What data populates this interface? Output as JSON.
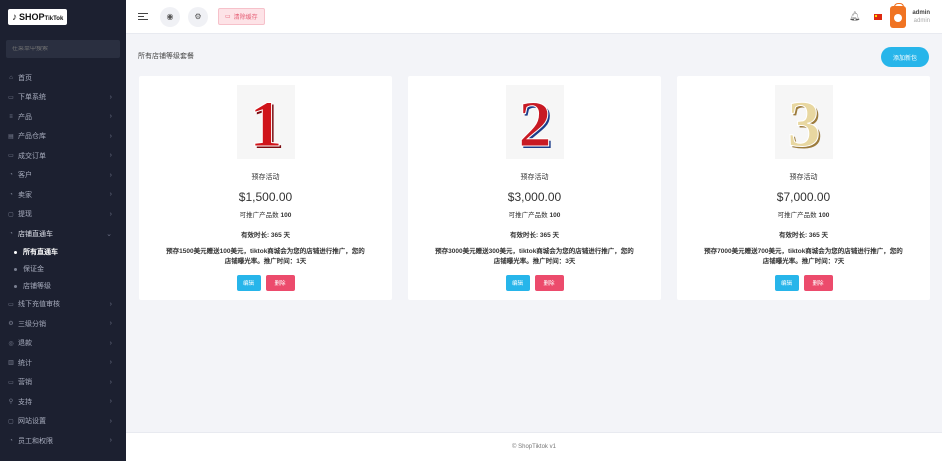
{
  "brand": {
    "logo_glyph": "♪",
    "logo_text": "SHOP",
    "logo_suffix": "TikTok"
  },
  "search": {
    "placeholder": "在菜单中搜索"
  },
  "sidebar": {
    "items": [
      {
        "label": "首页",
        "icon": "home-icon",
        "glyph": "⌂",
        "chevron": ""
      },
      {
        "label": "下单系统",
        "icon": "order-icon",
        "glyph": "▭",
        "chevron": "›"
      },
      {
        "label": "产品",
        "icon": "product-icon",
        "glyph": "≡",
        "chevron": "›"
      },
      {
        "label": "产品仓库",
        "icon": "warehouse-icon",
        "glyph": "▤",
        "chevron": "›"
      },
      {
        "label": "成交订单",
        "icon": "deal-icon",
        "glyph": "▭",
        "chevron": "›"
      },
      {
        "label": "客户",
        "icon": "customer-icon",
        "glyph": "◔",
        "chevron": "›"
      },
      {
        "label": "卖家",
        "icon": "seller-icon",
        "glyph": "◔",
        "chevron": "›"
      },
      {
        "label": "提现",
        "icon": "withdraw-icon",
        "glyph": "▢",
        "chevron": "›"
      },
      {
        "label": "店铺直通车",
        "icon": "store-icon",
        "glyph": "◔",
        "chevron": "⌄"
      },
      {
        "label": "所有直通车",
        "sub": true,
        "current": true
      },
      {
        "label": "保证金",
        "sub": true
      },
      {
        "label": "店铺等级",
        "sub": true
      },
      {
        "label": "线下充值审核",
        "icon": "recharge-icon",
        "glyph": "▭",
        "chevron": "›"
      },
      {
        "label": "三级分销",
        "icon": "distribution-icon",
        "glyph": "⚙",
        "chevron": "›"
      },
      {
        "label": "退款",
        "icon": "refund-icon",
        "glyph": "◎",
        "chevron": "›"
      },
      {
        "label": "统计",
        "icon": "stats-icon",
        "glyph": "▥",
        "chevron": "›"
      },
      {
        "label": "营销",
        "icon": "marketing-icon",
        "glyph": "▭",
        "chevron": "›"
      },
      {
        "label": "支持",
        "icon": "support-icon",
        "glyph": "⚲",
        "chevron": "›"
      },
      {
        "label": "网站设置",
        "icon": "settings-icon",
        "glyph": "▢",
        "chevron": "›"
      },
      {
        "label": "员工和权限",
        "icon": "staff-icon",
        "glyph": "◔",
        "chevron": "›"
      }
    ]
  },
  "topbar": {
    "clear_cache": "清除缓存",
    "user_name": "admin",
    "user_role": "admin"
  },
  "main": {
    "title": "所有店铺等级套餐",
    "add_button": "添加新包",
    "edit_label": "编辑",
    "delete_label": "删除",
    "cards": [
      {
        "digit": "1",
        "digit_color": "#d0141a",
        "digit_shadow": "#7a0a0e",
        "name": "预存活动",
        "price": "$1,500.00",
        "limit_label": "可推广产品数",
        "limit_value": "100",
        "duration": "有效时长: 365 天",
        "description": "预存1500美元赠送100美元，tiktok商城会为您的店铺进行推广，您的店铺曝光率。推广时间：1天"
      },
      {
        "digit": "2",
        "digit_color": "#c81a24",
        "digit_shadow": "#1b3c8a",
        "name": "预存活动",
        "price": "$3,000.00",
        "limit_label": "可推广产品数",
        "limit_value": "100",
        "duration": "有效时长: 365 天",
        "description": "预存3000美元赠送300美元，tiktok商城会为您的店铺进行推广，您的店铺曝光率。推广时间：3天"
      },
      {
        "digit": "3",
        "digit_color": "#e8d7a0",
        "digit_shadow": "#9c7b3c",
        "name": "预存活动",
        "price": "$7,000.00",
        "limit_label": "可推广产品数",
        "limit_value": "100",
        "duration": "有效时长: 365 天",
        "description": "预存7000美元赠送700美元，tiktok商城会为您的店铺进行推广，您的店铺曝光率。推广时间：7天"
      }
    ]
  },
  "footer": {
    "text": "© ShopTiktok v1"
  },
  "colors": {
    "accent": "#27b5ea",
    "danger": "#ec4b6c",
    "sidebar_bg": "#1c2030"
  }
}
